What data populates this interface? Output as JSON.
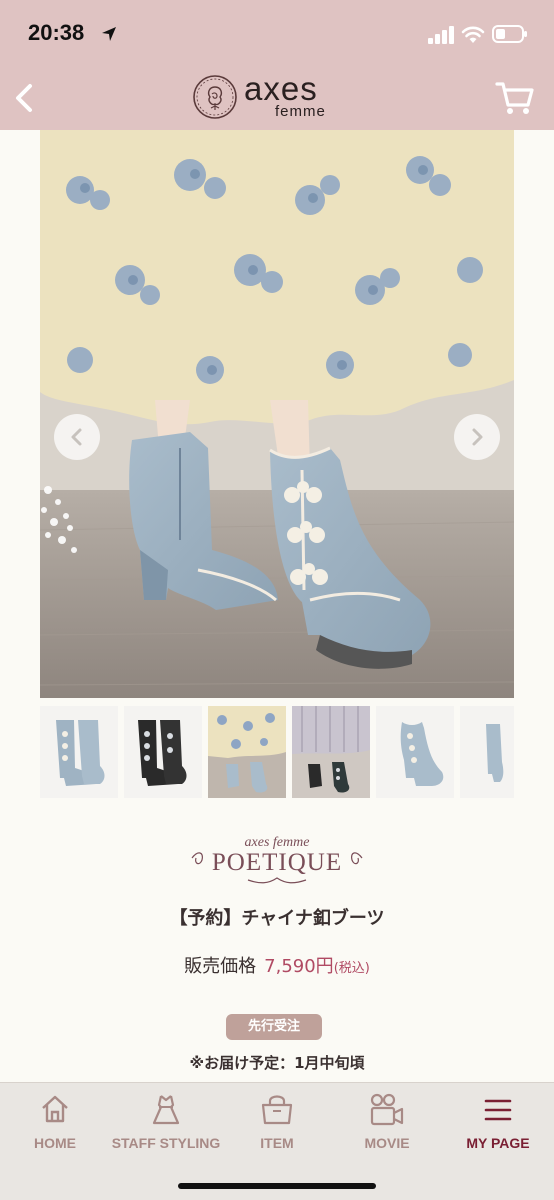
{
  "status_bar": {
    "time": "20:38",
    "icons": [
      "location-arrow-icon",
      "signal-icon",
      "wifi-icon",
      "battery-icon"
    ]
  },
  "header": {
    "back_icon": "chevron-left-icon",
    "logo_word": "axes",
    "logo_sub": "femme",
    "cart_icon": "cart-icon",
    "background": "#dfc3c2"
  },
  "gallery": {
    "prev_icon": "chevron-left-icon",
    "next_icon": "chevron-right-icon",
    "thumbnail_count": 6
  },
  "product": {
    "brand_small": "axes femme",
    "brand_big": "POETIQUE",
    "name": "【予約】チャイナ釦ブーツ",
    "price_label": "販売価格",
    "price_value": "7,590円",
    "price_tax": "(税込)",
    "badge": "先行受注",
    "delivery": "※お届け予定：1月中旬頃"
  },
  "tabbar": {
    "items": [
      {
        "label": "HOME",
        "icon": "home-icon"
      },
      {
        "label": "STAFF STYLING",
        "icon": "dress-icon"
      },
      {
        "label": "ITEM",
        "icon": "bag-icon"
      },
      {
        "label": "MOVIE",
        "icon": "video-camera-icon"
      },
      {
        "label": "MY PAGE",
        "icon": "menu-icon"
      }
    ],
    "active": "MY PAGE"
  },
  "colors": {
    "accent_price": "#b04a63",
    "active_tab": "#7a1f33",
    "inactive_tab": "#a88a86",
    "badge": "#bfa19a"
  }
}
